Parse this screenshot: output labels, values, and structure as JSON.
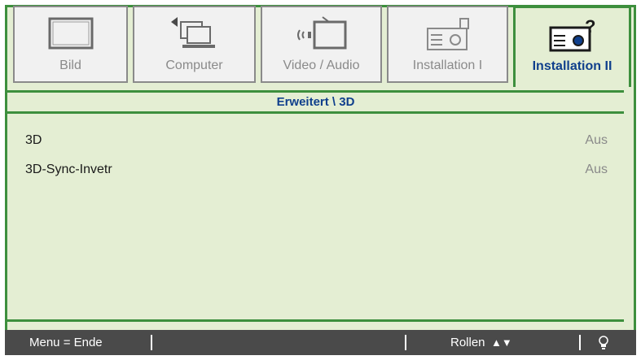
{
  "tabs": [
    {
      "label": "Bild",
      "icon": "monitor-icon",
      "active": false
    },
    {
      "label": "Computer",
      "icon": "computer-icon",
      "active": false
    },
    {
      "label": "Video / Audio",
      "icon": "video-audio-icon",
      "active": false
    },
    {
      "label": "Installation I",
      "icon": "projector-icon",
      "active": false
    },
    {
      "label": "Installation II",
      "icon": "projector-help-icon",
      "active": true
    }
  ],
  "breadcrumb": "Erweitert \\ 3D",
  "settings": [
    {
      "name": "3D",
      "value": "Aus"
    },
    {
      "name": "3D-Sync-Invetr",
      "value": "Aus"
    }
  ],
  "footer": {
    "menu_hint": "Menu = Ende",
    "scroll_hint": "Rollen",
    "scroll_arrows": "▲▼",
    "bulb_icon": "bulb-icon"
  },
  "colors": {
    "accent_green": "#3d8f3d",
    "panel_bg": "#e4eed3",
    "active_text": "#0f3f8c",
    "inactive_text": "#8a8a8a",
    "statusbar_bg": "#4a4a4a"
  }
}
